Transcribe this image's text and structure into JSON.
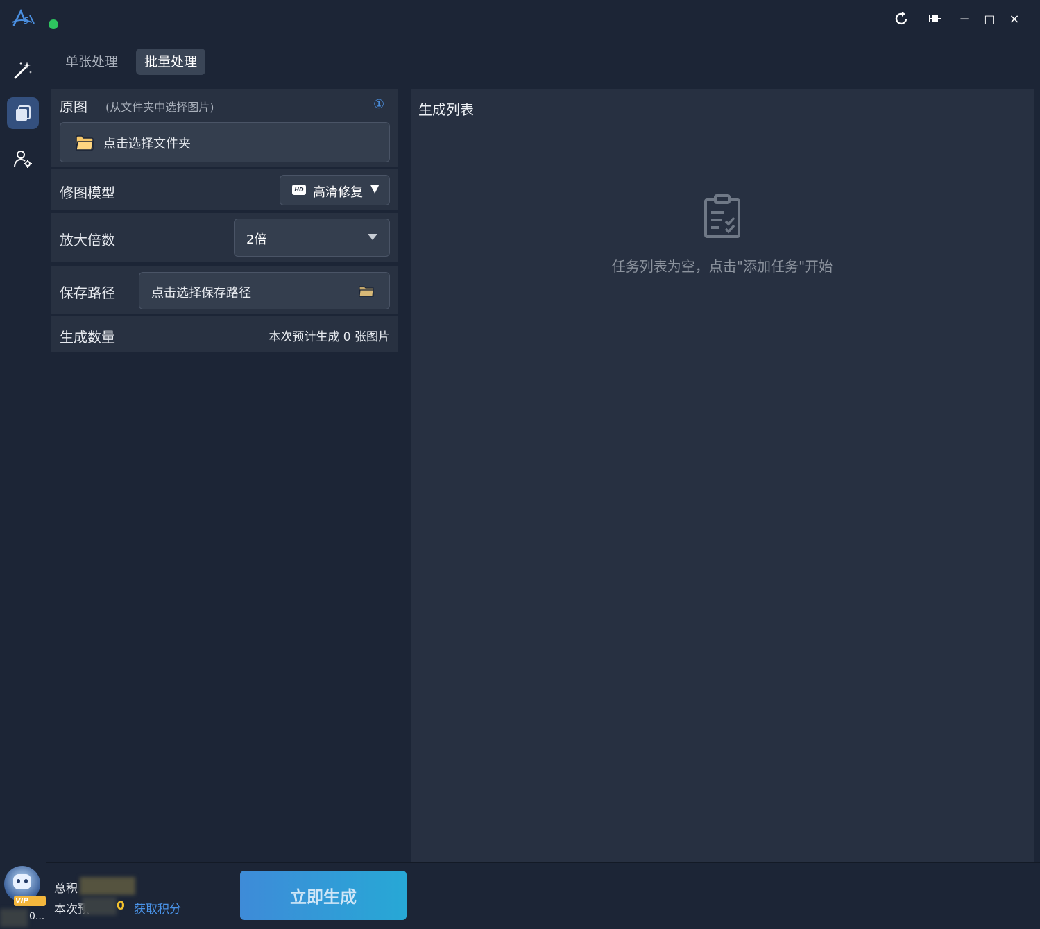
{
  "window": {
    "controls": {
      "refresh": "refresh-icon",
      "pin": "pin-icon",
      "minimize": "−",
      "maximize": "□",
      "close": "×"
    }
  },
  "colors": {
    "status": "#2ec45f",
    "accent": "#3e8bd8",
    "folder": "#f5c76a"
  },
  "tabs": {
    "single": "单张处理",
    "batch": "批量处理",
    "active": "batch"
  },
  "source": {
    "label": "原图",
    "hint": "(从文件夹中选择图片)",
    "info": "①",
    "select_folder": "点击选择文件夹"
  },
  "model": {
    "label": "修图模型",
    "badge": "HD",
    "value": "高清修复"
  },
  "scale": {
    "label": "放大倍数",
    "value": "2倍"
  },
  "save_path": {
    "label": "保存路径",
    "placeholder": "点击选择保存路径"
  },
  "count": {
    "label": "生成数量",
    "text": "本次预计生成 0 张图片"
  },
  "task_list": {
    "title": "生成列表",
    "empty": "任务列表为空，点击\"添加任务\"开始"
  },
  "footer": {
    "total_points_label": "总积",
    "this_time_label": "本次预",
    "this_time_tail": "0",
    "get_points": "获取积分",
    "vip_badge": "VIP",
    "user_tail": "0...",
    "generate": "立即生成"
  }
}
